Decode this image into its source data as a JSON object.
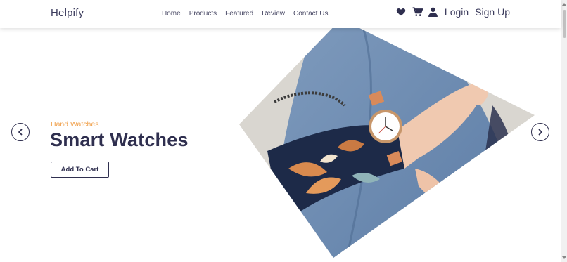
{
  "navbar": {
    "brand": "Helpify",
    "links": [
      "Home",
      "Products",
      "Featured",
      "Review",
      "Contact Us"
    ],
    "login_label": "Login",
    "signup_label": "Sign Up"
  },
  "hero": {
    "subtitle": "Hand Watches",
    "title": "Smart Watches",
    "cta_label": "Add To Cart"
  },
  "icons": {
    "wishlist": "heart-icon",
    "cart": "cart-icon",
    "account": "user-icon",
    "prev": "chevron-left-icon",
    "next": "chevron-right-icon"
  },
  "colors": {
    "accent": "#f0a04b",
    "primary_text": "#2f2f4f"
  }
}
